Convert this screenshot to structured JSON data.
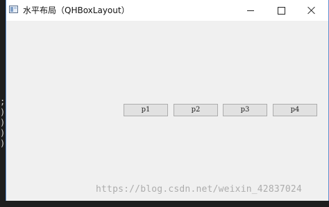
{
  "window": {
    "title": "水平布局（QHBoxLayout）",
    "controls": [
      "minimize-icon",
      "maximize-icon",
      "close-icon"
    ]
  },
  "buttons": [
    {
      "label": "p1"
    },
    {
      "label": "p2"
    },
    {
      "label": "p3"
    },
    {
      "label": "p4"
    }
  ],
  "background_glyphs": [
    ";",
    ")",
    ")",
    ")",
    ")"
  ],
  "watermark": "https://blog.csdn.net/weixin_42837024",
  "colors": {
    "window_bg": "#f0f0f0",
    "titlebar_bg": "#ffffff",
    "button_bg": "#e1e1e1",
    "button_border": "#adadad"
  }
}
